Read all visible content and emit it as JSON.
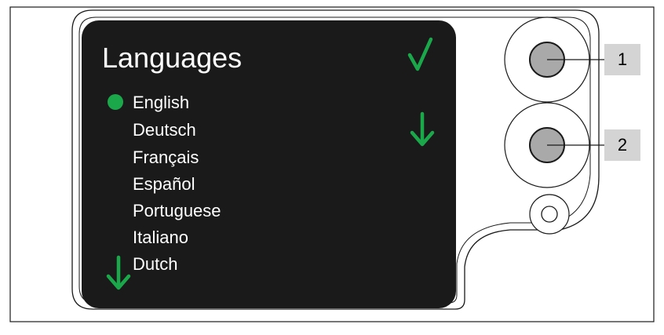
{
  "screen": {
    "title": "Languages",
    "selected_index": 0,
    "languages": [
      "English",
      "Deutsch",
      "Français",
      "Español",
      "Portuguese",
      "Italiano",
      "Dutch"
    ],
    "confirm_icon": "check-icon",
    "scroll_icon": "arrow-down-icon",
    "list_more_icon": "arrow-down-icon"
  },
  "callouts": [
    {
      "label": "1",
      "target": "button-1"
    },
    {
      "label": "2",
      "target": "button-2"
    }
  ],
  "colors": {
    "accent_green": "#1aa84a",
    "screen_bg": "#1a1a1a",
    "text": "#ffffff",
    "callout_bg": "#d4d4d4"
  }
}
